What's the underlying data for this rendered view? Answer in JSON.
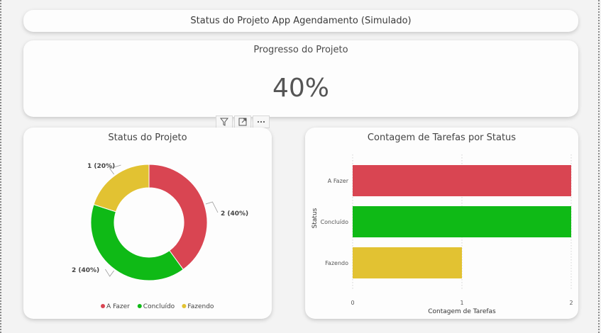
{
  "header": {
    "title": "Status do Projeto App Agendamento (Simulado)"
  },
  "kpi": {
    "title": "Progresso do Projeto",
    "value": "40%"
  },
  "visual_toolbar": [
    {
      "name": "filter-icon"
    },
    {
      "name": "focus-mode-icon"
    },
    {
      "name": "more-options-icon"
    }
  ],
  "colors": {
    "a_fazer": "#d94552",
    "concluido": "#0fba16",
    "fazendo": "#e2c232"
  },
  "chart_data": [
    {
      "type": "pie",
      "title": "Status do Projeto",
      "categories": [
        "A Fazer",
        "Concluído",
        "Fazendo"
      ],
      "values": [
        2,
        2,
        1
      ],
      "data_labels": [
        "2 (40%)",
        "2 (40%)",
        "1 (20%)"
      ],
      "colors": [
        "#d94552",
        "#0fba16",
        "#e2c232"
      ],
      "legend": "bottom"
    },
    {
      "type": "bar",
      "orientation": "horizontal",
      "title": "Contagem de Tarefas por Status",
      "categories": [
        "A Fazer",
        "Concluído",
        "Fazendo"
      ],
      "values": [
        2,
        2,
        1
      ],
      "colors": [
        "#d94552",
        "#0fba16",
        "#e2c232"
      ],
      "xlabel": "Contagem de Tarefas",
      "ylabel": "Status",
      "xlim": [
        0,
        2
      ],
      "xticks": [
        "0",
        "1",
        "2"
      ],
      "grid": true
    }
  ]
}
